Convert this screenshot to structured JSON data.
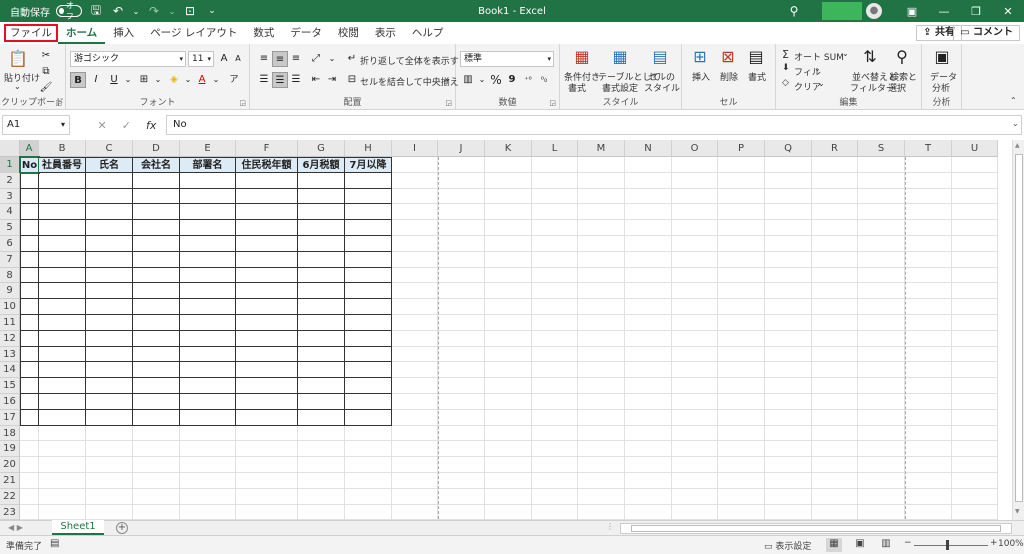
{
  "titlebar": {
    "autosave_label": "自動保存",
    "autosave_state": "オフ",
    "title": "Book1 - Excel",
    "icons": [
      "save-icon",
      "undo-icon",
      "redo-icon",
      "camera-icon",
      "customize-icon"
    ],
    "window_buttons": [
      "ribbon-display-icon",
      "minimize-icon",
      "restore-icon",
      "close-icon"
    ]
  },
  "tabs": [
    {
      "label": "ファイル",
      "id": "file"
    },
    {
      "label": "ホーム",
      "id": "home"
    },
    {
      "label": "挿入",
      "id": "insert"
    },
    {
      "label": "ページ レイアウト",
      "id": "page-layout"
    },
    {
      "label": "数式",
      "id": "formulas"
    },
    {
      "label": "データ",
      "id": "data"
    },
    {
      "label": "校閲",
      "id": "review"
    },
    {
      "label": "表示",
      "id": "view"
    },
    {
      "label": "ヘルプ",
      "id": "help"
    }
  ],
  "share_label": "共有",
  "comment_label": "コメント",
  "ribbon": {
    "clipboard": {
      "label": "クリップボード",
      "paste": "貼り付け"
    },
    "font": {
      "label": "フォント",
      "name": "游ゴシック",
      "size": "11",
      "grow": "A",
      "shrink": "A",
      "bold": "B",
      "italic": "I",
      "underline": "U",
      "font_color": "A"
    },
    "alignment": {
      "label": "配置",
      "wrap": "折り返して全体を表示する",
      "merge": "セルを結合して中央揃え"
    },
    "number": {
      "label": "数値",
      "format": "標準",
      "percent": "%",
      "comma": "9"
    },
    "styles": {
      "label": "スタイル",
      "conditional": [
        "条件付き",
        "書式"
      ],
      "as_table": [
        "テーブルとして",
        "書式設定"
      ],
      "cell_styles": [
        "セルの",
        "スタイル"
      ]
    },
    "cells": {
      "label": "セル",
      "insert": "挿入",
      "delete": "削除",
      "format": "書式"
    },
    "editing": {
      "label": "編集",
      "autosum": "オート SUM",
      "fill": "フィル",
      "clear": "クリア",
      "sort": [
        "並べ替えと",
        "フィルター"
      ],
      "find": [
        "検索と",
        "選択"
      ]
    },
    "analysis": {
      "label": "分析",
      "data_analysis": [
        "データ",
        "分析"
      ]
    }
  },
  "formula": {
    "namebox": "A1",
    "cancel": "✕",
    "enter": "✓",
    "fx": "fx",
    "value": "No"
  },
  "columns": [
    "A",
    "B",
    "C",
    "D",
    "E",
    "F",
    "G",
    "H",
    "I",
    "J",
    "K",
    "L",
    "M",
    "N",
    "O",
    "P",
    "Q",
    "R",
    "S",
    "T",
    "U"
  ],
  "rows": [
    "1",
    "2",
    "3",
    "4",
    "5",
    "6",
    "7",
    "8",
    "9",
    "10",
    "11",
    "12",
    "13",
    "14",
    "15",
    "16",
    "17",
    "18",
    "19",
    "20",
    "21",
    "22",
    "23"
  ],
  "table_headers": [
    "No",
    "社員番号",
    "氏名",
    "会社名",
    "部署名",
    "住民税年額",
    "6月税額",
    "7月以降"
  ],
  "sheet_tab": "Sheet1",
  "status": {
    "ready": "準備完了",
    "display_settings": "表示設定",
    "zoom_minus": "−",
    "zoom_plus": "+",
    "zoom": "100%"
  }
}
